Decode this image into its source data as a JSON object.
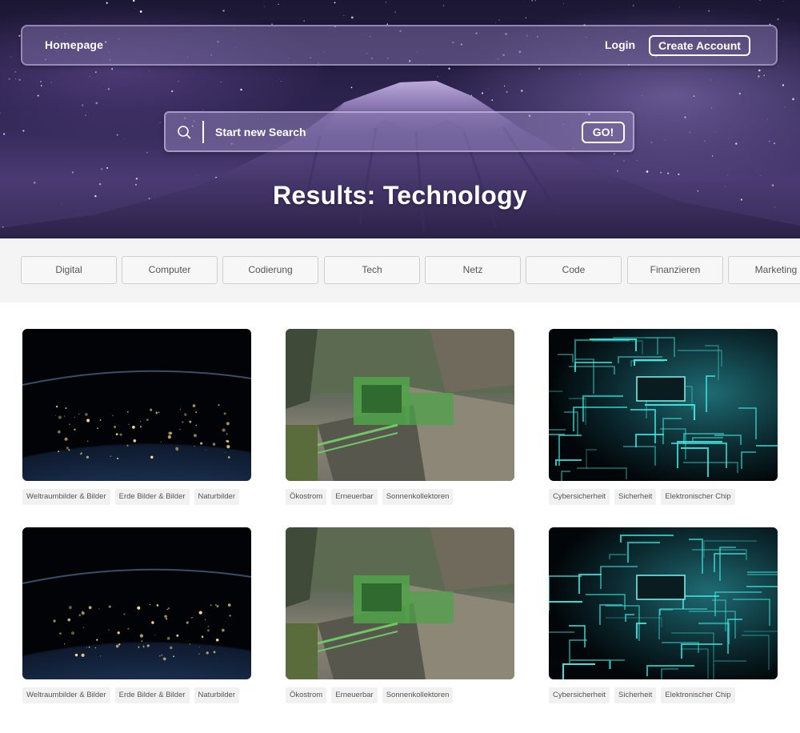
{
  "nav": {
    "home_label": "Homepage",
    "login_label": "Login",
    "create_account_label": "Create Account"
  },
  "search": {
    "placeholder": "Start new Search",
    "go_label": "GO!",
    "icon": "search-icon"
  },
  "results_title": "Results: Technology",
  "categories": [
    "Digital",
    "Computer",
    "Codierung",
    "Tech",
    "Netz",
    "Code",
    "Finanzieren",
    "Marketing"
  ],
  "results": [
    {
      "image": "earth-night-lights",
      "tags": [
        "Weltraumbilder & Bilder",
        "Erde Bilder & Bilder",
        "Naturbilder"
      ]
    },
    {
      "image": "green-dam-machinery",
      "tags": [
        "Ökostrom",
        "Erneuerbar",
        "Sonnenkollektoren"
      ]
    },
    {
      "image": "glowing-circuit-board",
      "tags": [
        "Cybersicherheit",
        "Sicherheit",
        "Elektronischer Chip"
      ]
    },
    {
      "image": "earth-night-lights",
      "tags": [
        "Weltraumbilder & Bilder",
        "Erde Bilder & Bilder",
        "Naturbilder"
      ]
    },
    {
      "image": "green-dam-machinery",
      "tags": [
        "Ökostrom",
        "Erneuerbar",
        "Sonnenkollektoren"
      ]
    },
    {
      "image": "glowing-circuit-board",
      "tags": [
        "Cybersicherheit",
        "Sicherheit",
        "Elektronischer Chip"
      ]
    }
  ],
  "colors": {
    "hero_purple": "#4a3a72",
    "chip_border": "#cfcfcf",
    "tag_bg": "#f1f1f1",
    "circuit_cyan": "#3fe6e0",
    "dam_green": "#4fa34a"
  }
}
